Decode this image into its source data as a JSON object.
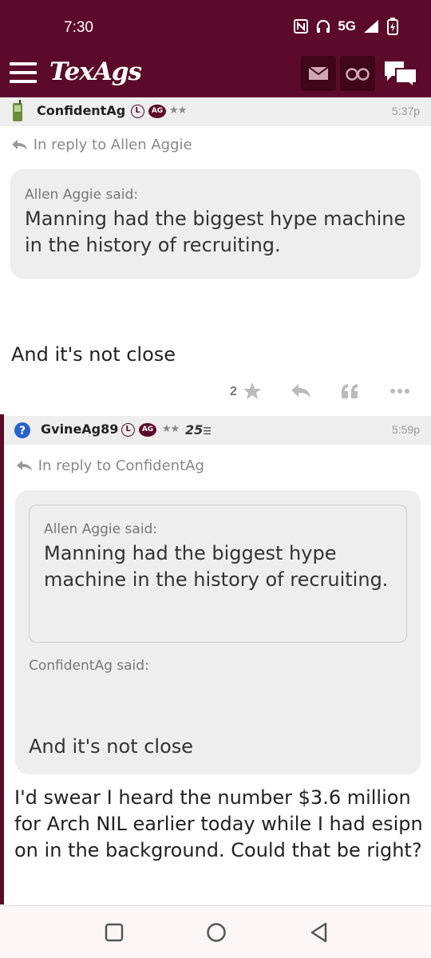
{
  "status_bar": {
    "time": "7:30",
    "network": "5G"
  },
  "app": {
    "title": "TexAgs"
  },
  "post1": {
    "username": "ConfidentAg",
    "badge_l": "L",
    "badge_ag": "AG",
    "stars": "★★",
    "time": "5:37p",
    "reply_to": "In reply to Allen Aggie",
    "quote_author": "Allen Aggie said:",
    "quote_text": "Manning had the biggest hype machine in the history of recruiting.",
    "body": "And it's not close",
    "star_count": "2"
  },
  "post2": {
    "username": "GvineAg89",
    "badge_l": "L",
    "badge_ag": "AG",
    "stars": "★★",
    "extra_badge": "25",
    "time": "5:59p",
    "reply_to": "In reply to ConfidentAg",
    "nested_quote_author": "Allen Aggie said:",
    "nested_quote_text": "Manning had the biggest hype machine in the history of recruiting.",
    "quote_author": "ConfidentAg said:",
    "quote_text": "And it's not close",
    "body": "I'd swear I heard the number $3.6 million for Arch NIL earlier today while I had esipn on in the background. Could that be right?"
  },
  "colors": {
    "brand": "#5c0a2a",
    "quote_bg": "#eeeeee"
  },
  "icons": [
    "menu-icon",
    "mail-icon",
    "binoculars-icon",
    "chat-icon",
    "phone-icon",
    "question-icon",
    "star-icon",
    "reply-icon",
    "quote-icon",
    "more-icon",
    "square-nav-icon",
    "circle-nav-icon",
    "back-nav-icon"
  ]
}
